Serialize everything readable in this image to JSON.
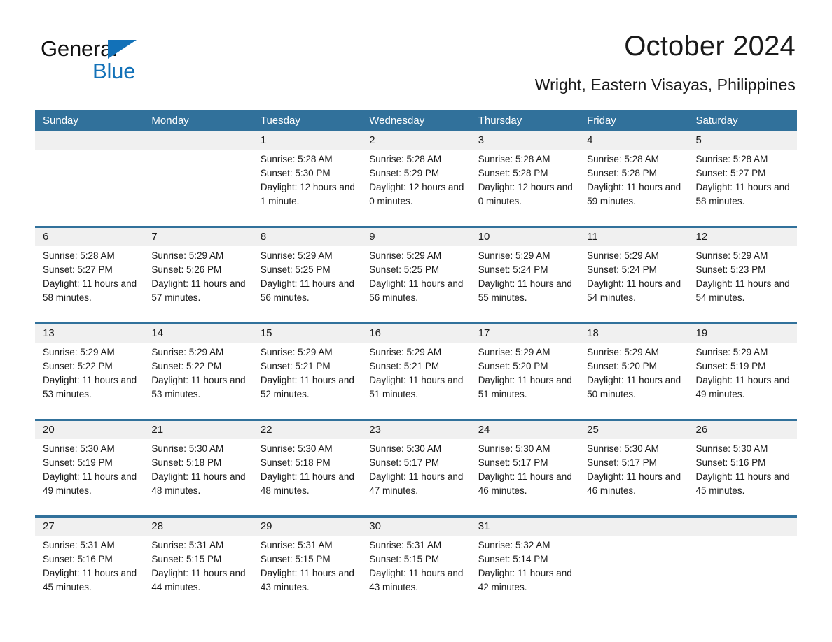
{
  "logo": {
    "word1": "General",
    "word2": "Blue",
    "triangle_color": "#1271b8",
    "icon": "triangle-icon"
  },
  "header": {
    "title": "October 2024",
    "subtitle": "Wright, Eastern Visayas, Philippines"
  },
  "colors": {
    "header_blue": "#31719b",
    "number_band": "#f0f0f0",
    "text": "#1a1a1a",
    "header_text": "#ffffff"
  },
  "weekday_headers": [
    "Sunday",
    "Monday",
    "Tuesday",
    "Wednesday",
    "Thursday",
    "Friday",
    "Saturday"
  ],
  "weeks": [
    [
      {
        "day": "",
        "sunrise": "",
        "sunset": "",
        "daylight": ""
      },
      {
        "day": "",
        "sunrise": "",
        "sunset": "",
        "daylight": ""
      },
      {
        "day": "1",
        "sunrise": "Sunrise: 5:28 AM",
        "sunset": "Sunset: 5:30 PM",
        "daylight": "Daylight: 12 hours and 1 minute."
      },
      {
        "day": "2",
        "sunrise": "Sunrise: 5:28 AM",
        "sunset": "Sunset: 5:29 PM",
        "daylight": "Daylight: 12 hours and 0 minutes."
      },
      {
        "day": "3",
        "sunrise": "Sunrise: 5:28 AM",
        "sunset": "Sunset: 5:28 PM",
        "daylight": "Daylight: 12 hours and 0 minutes."
      },
      {
        "day": "4",
        "sunrise": "Sunrise: 5:28 AM",
        "sunset": "Sunset: 5:28 PM",
        "daylight": "Daylight: 11 hours and 59 minutes."
      },
      {
        "day": "5",
        "sunrise": "Sunrise: 5:28 AM",
        "sunset": "Sunset: 5:27 PM",
        "daylight": "Daylight: 11 hours and 58 minutes."
      }
    ],
    [
      {
        "day": "6",
        "sunrise": "Sunrise: 5:28 AM",
        "sunset": "Sunset: 5:27 PM",
        "daylight": "Daylight: 11 hours and 58 minutes."
      },
      {
        "day": "7",
        "sunrise": "Sunrise: 5:29 AM",
        "sunset": "Sunset: 5:26 PM",
        "daylight": "Daylight: 11 hours and 57 minutes."
      },
      {
        "day": "8",
        "sunrise": "Sunrise: 5:29 AM",
        "sunset": "Sunset: 5:25 PM",
        "daylight": "Daylight: 11 hours and 56 minutes."
      },
      {
        "day": "9",
        "sunrise": "Sunrise: 5:29 AM",
        "sunset": "Sunset: 5:25 PM",
        "daylight": "Daylight: 11 hours and 56 minutes."
      },
      {
        "day": "10",
        "sunrise": "Sunrise: 5:29 AM",
        "sunset": "Sunset: 5:24 PM",
        "daylight": "Daylight: 11 hours and 55 minutes."
      },
      {
        "day": "11",
        "sunrise": "Sunrise: 5:29 AM",
        "sunset": "Sunset: 5:24 PM",
        "daylight": "Daylight: 11 hours and 54 minutes."
      },
      {
        "day": "12",
        "sunrise": "Sunrise: 5:29 AM",
        "sunset": "Sunset: 5:23 PM",
        "daylight": "Daylight: 11 hours and 54 minutes."
      }
    ],
    [
      {
        "day": "13",
        "sunrise": "Sunrise: 5:29 AM",
        "sunset": "Sunset: 5:22 PM",
        "daylight": "Daylight: 11 hours and 53 minutes."
      },
      {
        "day": "14",
        "sunrise": "Sunrise: 5:29 AM",
        "sunset": "Sunset: 5:22 PM",
        "daylight": "Daylight: 11 hours and 53 minutes."
      },
      {
        "day": "15",
        "sunrise": "Sunrise: 5:29 AM",
        "sunset": "Sunset: 5:21 PM",
        "daylight": "Daylight: 11 hours and 52 minutes."
      },
      {
        "day": "16",
        "sunrise": "Sunrise: 5:29 AM",
        "sunset": "Sunset: 5:21 PM",
        "daylight": "Daylight: 11 hours and 51 minutes."
      },
      {
        "day": "17",
        "sunrise": "Sunrise: 5:29 AM",
        "sunset": "Sunset: 5:20 PM",
        "daylight": "Daylight: 11 hours and 51 minutes."
      },
      {
        "day": "18",
        "sunrise": "Sunrise: 5:29 AM",
        "sunset": "Sunset: 5:20 PM",
        "daylight": "Daylight: 11 hours and 50 minutes."
      },
      {
        "day": "19",
        "sunrise": "Sunrise: 5:29 AM",
        "sunset": "Sunset: 5:19 PM",
        "daylight": "Daylight: 11 hours and 49 minutes."
      }
    ],
    [
      {
        "day": "20",
        "sunrise": "Sunrise: 5:30 AM",
        "sunset": "Sunset: 5:19 PM",
        "daylight": "Daylight: 11 hours and 49 minutes."
      },
      {
        "day": "21",
        "sunrise": "Sunrise: 5:30 AM",
        "sunset": "Sunset: 5:18 PM",
        "daylight": "Daylight: 11 hours and 48 minutes."
      },
      {
        "day": "22",
        "sunrise": "Sunrise: 5:30 AM",
        "sunset": "Sunset: 5:18 PM",
        "daylight": "Daylight: 11 hours and 48 minutes."
      },
      {
        "day": "23",
        "sunrise": "Sunrise: 5:30 AM",
        "sunset": "Sunset: 5:17 PM",
        "daylight": "Daylight: 11 hours and 47 minutes."
      },
      {
        "day": "24",
        "sunrise": "Sunrise: 5:30 AM",
        "sunset": "Sunset: 5:17 PM",
        "daylight": "Daylight: 11 hours and 46 minutes."
      },
      {
        "day": "25",
        "sunrise": "Sunrise: 5:30 AM",
        "sunset": "Sunset: 5:17 PM",
        "daylight": "Daylight: 11 hours and 46 minutes."
      },
      {
        "day": "26",
        "sunrise": "Sunrise: 5:30 AM",
        "sunset": "Sunset: 5:16 PM",
        "daylight": "Daylight: 11 hours and 45 minutes."
      }
    ],
    [
      {
        "day": "27",
        "sunrise": "Sunrise: 5:31 AM",
        "sunset": "Sunset: 5:16 PM",
        "daylight": "Daylight: 11 hours and 45 minutes."
      },
      {
        "day": "28",
        "sunrise": "Sunrise: 5:31 AM",
        "sunset": "Sunset: 5:15 PM",
        "daylight": "Daylight: 11 hours and 44 minutes."
      },
      {
        "day": "29",
        "sunrise": "Sunrise: 5:31 AM",
        "sunset": "Sunset: 5:15 PM",
        "daylight": "Daylight: 11 hours and 43 minutes."
      },
      {
        "day": "30",
        "sunrise": "Sunrise: 5:31 AM",
        "sunset": "Sunset: 5:15 PM",
        "daylight": "Daylight: 11 hours and 43 minutes."
      },
      {
        "day": "31",
        "sunrise": "Sunrise: 5:32 AM",
        "sunset": "Sunset: 5:14 PM",
        "daylight": "Daylight: 11 hours and 42 minutes."
      },
      {
        "day": "",
        "sunrise": "",
        "sunset": "",
        "daylight": ""
      },
      {
        "day": "",
        "sunrise": "",
        "sunset": "",
        "daylight": ""
      }
    ]
  ]
}
